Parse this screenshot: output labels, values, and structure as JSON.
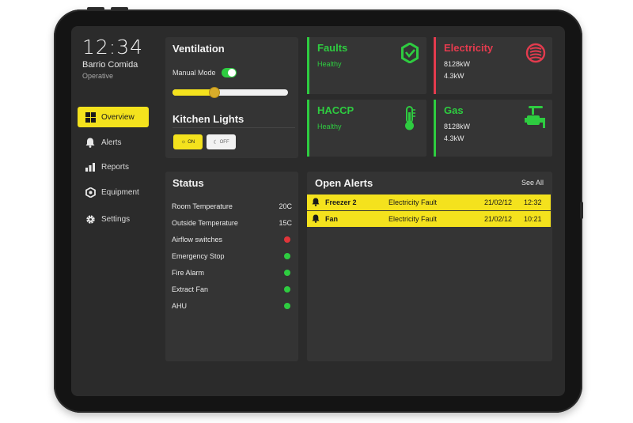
{
  "header": {
    "time": "12:34",
    "venue": "Barrio Comida",
    "status": "Operative"
  },
  "nav": [
    {
      "label": "Overview",
      "icon": "grid-icon",
      "active": true
    },
    {
      "label": "Alerts",
      "icon": "bell-icon",
      "active": false
    },
    {
      "label": "Reports",
      "icon": "bar-chart-icon",
      "active": false
    },
    {
      "label": "Equipment",
      "icon": "hexagon-icon",
      "active": false
    },
    {
      "label": "Settings",
      "icon": "gear-icon",
      "active": false
    }
  ],
  "ventilation": {
    "title": "Ventilation",
    "manual_mode_label": "Manual Mode",
    "manual_mode_on": true,
    "level": 0.36
  },
  "kitchen_lights": {
    "title": "Kitchen Lights",
    "on_label": "ON",
    "off_label": "OFF"
  },
  "tiles": {
    "faults": {
      "title": "Faults",
      "status": "Healthy",
      "icon": "hexagon-check-icon",
      "color": "#2ecc40"
    },
    "electricity": {
      "title": "Electricity",
      "value1": "8128kW",
      "value2": "4.3kW",
      "icon": "heat-coil-icon",
      "color": "#e33b4e"
    },
    "haccp": {
      "title": "HACCP",
      "status": "Healthy",
      "icon": "thermometer-icon",
      "color": "#2ecc40"
    },
    "gas": {
      "title": "Gas",
      "value1": "8128kW",
      "value2": "4.3kW",
      "icon": "valve-icon",
      "color": "#2ecc40"
    }
  },
  "status": {
    "title": "Status",
    "rows": [
      {
        "label": "Room Temperature",
        "value": "20C"
      },
      {
        "label": "Outside Temperature",
        "value": "15C"
      },
      {
        "label": "Airflow switches",
        "indicator": "red"
      },
      {
        "label": "Emergency Stop",
        "indicator": "green"
      },
      {
        "label": "Fire Alarm",
        "indicator": "green"
      },
      {
        "label": "Extract Fan",
        "indicator": "green"
      },
      {
        "label": "AHU",
        "indicator": "green"
      }
    ]
  },
  "alerts": {
    "title": "Open Alerts",
    "see_all": "See All",
    "rows": [
      {
        "device": "Freezer 2",
        "type": "Electricity Fault",
        "date": "21/02/12",
        "time": "12:32"
      },
      {
        "device": "Fan",
        "type": "Electricity Fault",
        "date": "21/02/12",
        "time": "10:21"
      }
    ]
  },
  "colors": {
    "accent": "#f4e21d",
    "healthy": "#2ecc40",
    "alert": "#e33b4e",
    "indicator_red": "#e0353a"
  }
}
